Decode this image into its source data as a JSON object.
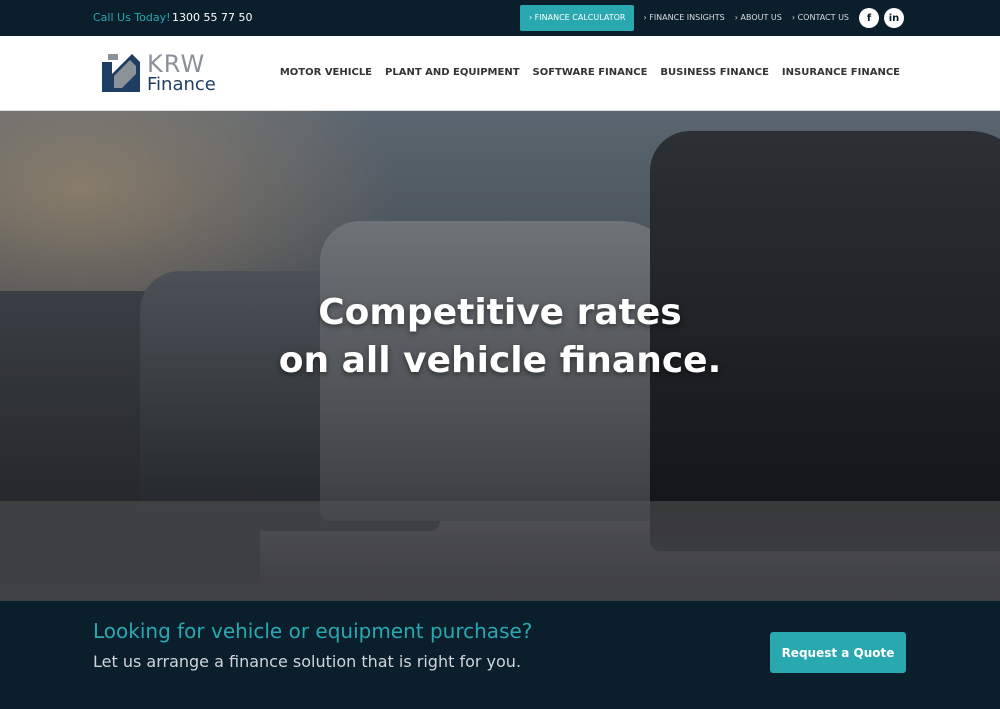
{
  "topbar": {
    "call_label": "Call Us Today!",
    "phone": "1300 55 77 50",
    "links": [
      "› FINANCE CALCULATOR",
      "› FINANCE INSIGHTS",
      "› ABOUT US",
      "› CONTACT US"
    ],
    "social": [
      "f",
      "in"
    ]
  },
  "header": {
    "logo_line1": "KRW",
    "logo_line2": "Finance",
    "nav": [
      "MOTOR VEHICLE",
      "PLANT AND EQUIPMENT",
      "SOFTWARE FINANCE",
      "BUSINESS FINANCE",
      "INSURANCE FINANCE"
    ]
  },
  "hero": {
    "line1": "Competitive rates",
    "line2": "on all vehicle finance."
  },
  "cta": {
    "heading": "Looking for vehicle or equipment purchase?",
    "text": "Let us arrange a finance solution that is right for you.",
    "button": "Request a Quote"
  },
  "colors": {
    "accent": "#2aa8b0",
    "dark": "#0b1e2c",
    "logo_blue": "#1e3f63"
  }
}
